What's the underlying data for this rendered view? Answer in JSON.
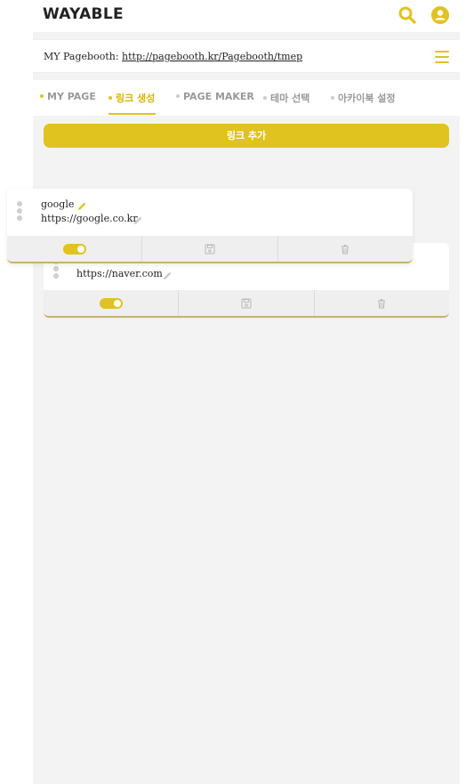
{
  "header": {
    "logo": "WAYABLE",
    "search_icon": "search-icon",
    "user_icon": "user-icon"
  },
  "url_bar": {
    "label_prefix": "MY Pagebooth: ",
    "url": "http://pagebooth.kr/Pagebooth/tmep",
    "menu_icon": "hamburger-icon"
  },
  "tabs": [
    {
      "label": "MY PAGE",
      "active": false
    },
    {
      "label": "링크 생성",
      "active": true
    },
    {
      "label": "PAGE MAKER",
      "active": false
    },
    {
      "label": "테마 선택",
      "active": false
    },
    {
      "label": "아카이북 설정",
      "active": false
    }
  ],
  "add_link_button": "링크 추가",
  "links": [
    {
      "title": "google",
      "url": "https://google.co.kr",
      "enabled": true
    },
    {
      "title": "",
      "url": "https://naver.com",
      "enabled": true
    }
  ],
  "colors": {
    "accent": "#e0c31f",
    "background": "#f3f3f3"
  }
}
